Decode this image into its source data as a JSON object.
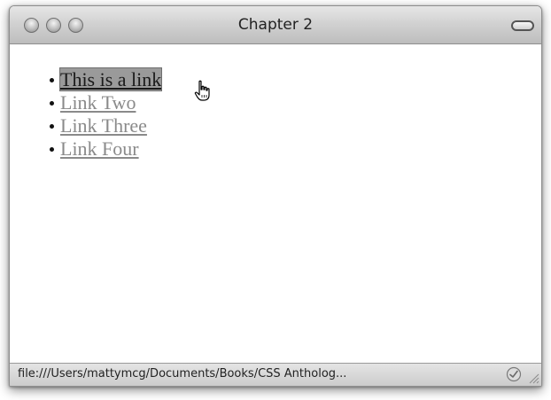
{
  "window": {
    "title": "Chapter 2"
  },
  "links": [
    {
      "label": "This is a link",
      "state": "hover"
    },
    {
      "label": "Link Two",
      "state": "normal"
    },
    {
      "label": "Link Three",
      "state": "normal"
    },
    {
      "label": "Link Four",
      "state": "normal"
    }
  ],
  "statusbar": {
    "text": "file:///Users/mattymcg/Documents/Books/CSS Antholog...",
    "icon": "check-icon"
  },
  "colors": {
    "link": "#8a8a8a",
    "link_hover_text": "#1a1a1a",
    "link_hover_bg": "#9a9a9a"
  }
}
